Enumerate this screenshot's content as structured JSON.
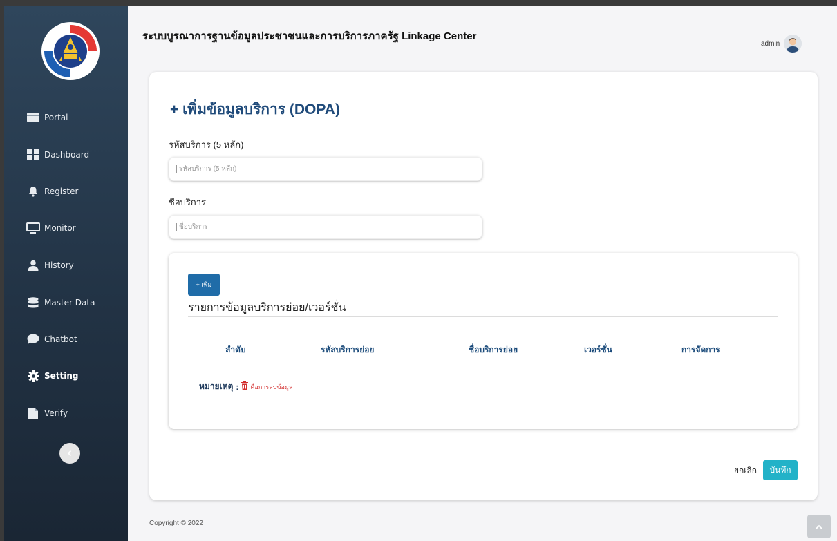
{
  "app": {
    "title": "ระบบบูรณาการฐานข้อมูลประชาชนและการบริการภาครัฐ Linkage Center",
    "user": "admin",
    "copyright": "Copyright © 2022"
  },
  "sidebar": {
    "items": [
      {
        "label": "Portal",
        "icon": "portal-icon"
      },
      {
        "label": "Dashboard",
        "icon": "dashboard-icon"
      },
      {
        "label": "Register",
        "icon": "bell-icon"
      },
      {
        "label": "Monitor",
        "icon": "monitor-icon"
      },
      {
        "label": "History",
        "icon": "user-icon"
      },
      {
        "label": "Master Data",
        "icon": "database-icon"
      },
      {
        "label": "Chatbot",
        "icon": "chat-icon"
      },
      {
        "label": "Setting",
        "icon": "gear-icon",
        "active": true
      },
      {
        "label": "Verify",
        "icon": "file-icon"
      }
    ]
  },
  "form": {
    "title": "+ เพิ่มข้อมูลบริการ (DOPA)",
    "service_code": {
      "label": "รหัสบริการ (5 หลัก)",
      "placeholder": "รหัสบริการ (5 หลัก)"
    },
    "service_name": {
      "label": "ชื่อบริการ",
      "placeholder": "ชื่อบริการ"
    }
  },
  "sub_services": {
    "add_label": "+ เพิ่ม",
    "title": "รายการข้อมูลบริการย่อย/เวอร์ชั่น",
    "columns": [
      "ลำดับ",
      "รหัสบริการย่อย",
      "ชื่อบริการย่อย",
      "เวอร์ชั่น",
      "การจัดการ"
    ],
    "note_label": "หมายเหตุ",
    "note_text": "คือการลบข้อมูล"
  },
  "actions": {
    "cancel": "ยกเลิก",
    "save": "บันทึก"
  },
  "colors": {
    "sidebar": "#2f465c",
    "primary": "#1f6ca8",
    "save": "#22b2c8",
    "delete": "#d32f2f"
  }
}
